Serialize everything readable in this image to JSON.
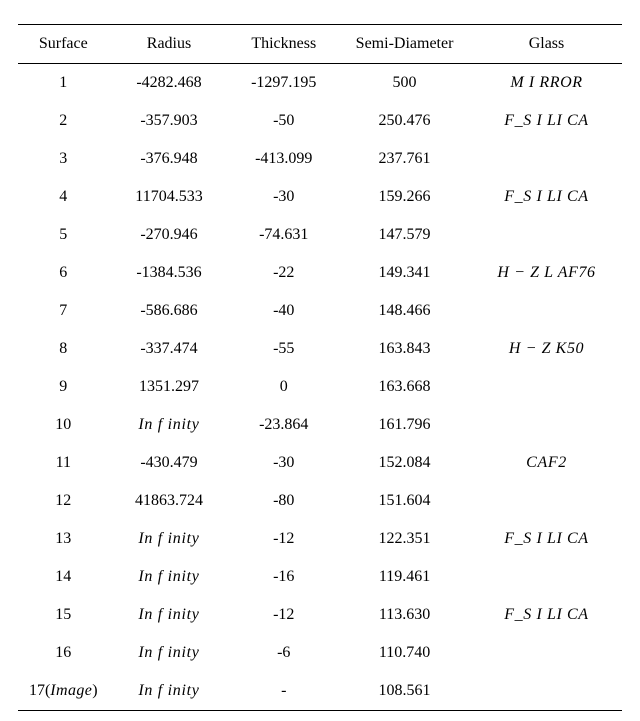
{
  "table": {
    "headers": {
      "surface": "Surface",
      "radius": "Radius",
      "thickness": "Thickness",
      "semidiameter": "Semi-Diameter",
      "glass": "Glass"
    },
    "rows": [
      {
        "surface": "1",
        "radius": "-4282.468",
        "thickness": "-1297.195",
        "semidiameter": "500",
        "glass": "MIRROR",
        "glass_html": "M I RROR"
      },
      {
        "surface": "2",
        "radius": "-357.903",
        "thickness": "-50",
        "semidiameter": "250.476",
        "glass": "F_SILICA",
        "glass_html": "F_S I LI CA"
      },
      {
        "surface": "3",
        "radius": "-376.948",
        "thickness": "-413.099",
        "semidiameter": "237.761",
        "glass": ""
      },
      {
        "surface": "4",
        "radius": "11704.533",
        "thickness": "-30",
        "semidiameter": "159.266",
        "glass": "F_SILICA",
        "glass_html": "F_S I LI CA"
      },
      {
        "surface": "5",
        "radius": "-270.946",
        "thickness": "-74.631",
        "semidiameter": "147.579",
        "glass": ""
      },
      {
        "surface": "6",
        "radius": "-1384.536",
        "thickness": "-22",
        "semidiameter": "149.341",
        "glass": "H − ZLAF76",
        "glass_html": "H − Z L AF76"
      },
      {
        "surface": "7",
        "radius": "-586.686",
        "thickness": "-40",
        "semidiameter": "148.466",
        "glass": ""
      },
      {
        "surface": "8",
        "radius": "-337.474",
        "thickness": "-55",
        "semidiameter": "163.843",
        "glass": "H − ZK50",
        "glass_html": "H − Z K50"
      },
      {
        "surface": "9",
        "radius": "1351.297",
        "thickness": "0",
        "semidiameter": "163.668",
        "glass": ""
      },
      {
        "surface": "10",
        "radius": "Infinity",
        "radius_ital": true,
        "thickness": "-23.864",
        "semidiameter": "161.796",
        "glass": ""
      },
      {
        "surface": "11",
        "radius": "-430.479",
        "thickness": "-30",
        "semidiameter": "152.084",
        "glass": "CAF2",
        "glass_html": "CAF2"
      },
      {
        "surface": "12",
        "radius": "41863.724",
        "thickness": "-80",
        "semidiameter": "151.604",
        "glass": ""
      },
      {
        "surface": "13",
        "radius": "Infinity",
        "radius_ital": true,
        "thickness": "-12",
        "semidiameter": "122.351",
        "glass": "F_SILICA",
        "glass_html": "F_S I LI CA"
      },
      {
        "surface": "14",
        "radius": "Infinity",
        "radius_ital": true,
        "thickness": "-16",
        "semidiameter": "119.461",
        "glass": ""
      },
      {
        "surface": "15",
        "radius": "Infinity",
        "radius_ital": true,
        "thickness": "-12",
        "semidiameter": "113.630",
        "glass": "F_SILICA",
        "glass_html": "F_S I LI CA"
      },
      {
        "surface": "16",
        "radius": "Infinity",
        "radius_ital": true,
        "thickness": "-6",
        "semidiameter": "110.740",
        "glass": ""
      },
      {
        "surface": "17(Image)",
        "surface_html": "17(<span class='ital'>Image</span>)",
        "radius": "Infinity",
        "radius_ital": true,
        "thickness": "-",
        "semidiameter": "108.561",
        "glass": ""
      }
    ]
  },
  "chart_data": {
    "type": "table",
    "title": "",
    "columns": [
      "Surface",
      "Radius",
      "Thickness",
      "Semi-Diameter",
      "Glass"
    ],
    "rows": [
      [
        "1",
        -4282.468,
        -1297.195,
        500,
        "MIRROR"
      ],
      [
        "2",
        -357.903,
        -50,
        250.476,
        "F_SILICA"
      ],
      [
        "3",
        -376.948,
        -413.099,
        237.761,
        ""
      ],
      [
        "4",
        11704.533,
        -30,
        159.266,
        "F_SILICA"
      ],
      [
        "5",
        -270.946,
        -74.631,
        147.579,
        ""
      ],
      [
        "6",
        -1384.536,
        -22,
        149.341,
        "H-ZLAF76"
      ],
      [
        "7",
        -586.686,
        -40,
        148.466,
        ""
      ],
      [
        "8",
        -337.474,
        -55,
        163.843,
        "H-ZK50"
      ],
      [
        "9",
        1351.297,
        0,
        163.668,
        ""
      ],
      [
        "10",
        "Infinity",
        -23.864,
        161.796,
        ""
      ],
      [
        "11",
        -430.479,
        -30,
        152.084,
        "CAF2"
      ],
      [
        "12",
        41863.724,
        -80,
        151.604,
        ""
      ],
      [
        "13",
        "Infinity",
        -12,
        122.351,
        "F_SILICA"
      ],
      [
        "14",
        "Infinity",
        -16,
        119.461,
        ""
      ],
      [
        "15",
        "Infinity",
        -12,
        113.63,
        "F_SILICA"
      ],
      [
        "16",
        "Infinity",
        -6,
        110.74,
        ""
      ],
      [
        "17(Image)",
        "Infinity",
        null,
        108.561,
        ""
      ]
    ]
  }
}
